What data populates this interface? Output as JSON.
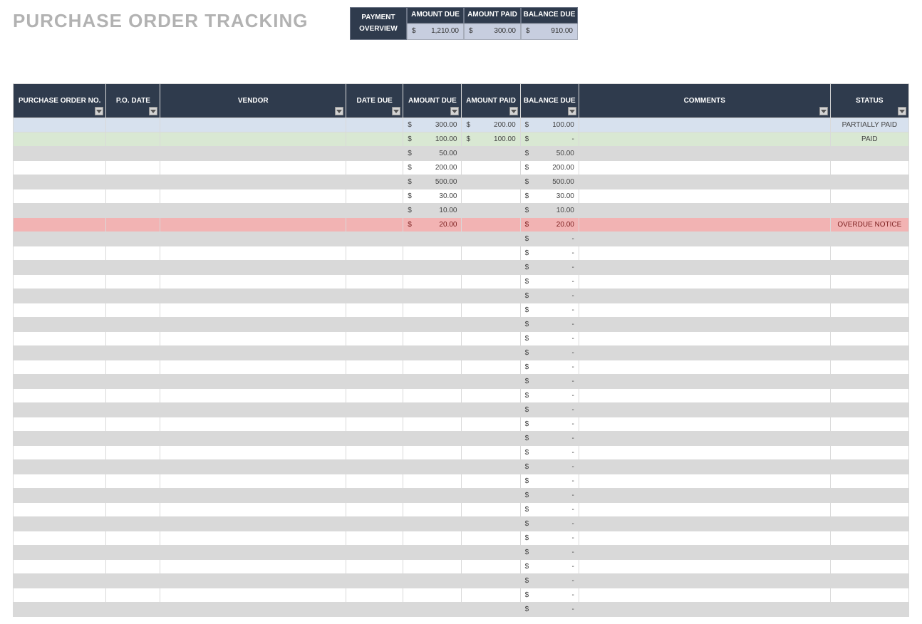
{
  "title": "PURCHASE ORDER TRACKING",
  "overview": {
    "label_line1": "PAYMENT",
    "label_line2": "OVERVIEW",
    "amount_due_label": "AMOUNT DUE",
    "amount_paid_label": "AMOUNT PAID",
    "balance_due_label": "BALANCE DUE",
    "amount_due": "1,210.00",
    "amount_paid": "300.00",
    "balance_due": "910.00",
    "currency": "$"
  },
  "columns": {
    "po_no": "PURCHASE ORDER NO.",
    "po_date": "P.O. DATE",
    "vendor": "VENDOR",
    "date_due": "DATE DUE",
    "amount_due": "AMOUNT DUE",
    "amount_paid": "AMOUNT PAID",
    "balance_due": "BALANCE DUE",
    "comments": "COMMENTS",
    "status": "STATUS"
  },
  "currency": "$",
  "dash": "-",
  "rows": [
    {
      "row_class": "blue",
      "amount_due": "300.00",
      "amount_paid": "200.00",
      "balance_due": "100.00",
      "status": "PARTIALLY PAID"
    },
    {
      "row_class": "green",
      "amount_due": "100.00",
      "amount_paid": "100.00",
      "balance_due": "-",
      "status": "PAID"
    },
    {
      "row_class": "alt",
      "amount_due": "50.00",
      "amount_paid": "",
      "balance_due": "50.00",
      "status": ""
    },
    {
      "row_class": "",
      "amount_due": "200.00",
      "amount_paid": "",
      "balance_due": "200.00",
      "status": ""
    },
    {
      "row_class": "alt",
      "amount_due": "500.00",
      "amount_paid": "",
      "balance_due": "500.00",
      "status": ""
    },
    {
      "row_class": "",
      "amount_due": "30.00",
      "amount_paid": "",
      "balance_due": "30.00",
      "status": ""
    },
    {
      "row_class": "alt",
      "amount_due": "10.00",
      "amount_paid": "",
      "balance_due": "10.00",
      "status": ""
    },
    {
      "row_class": "red",
      "amount_due": "20.00",
      "amount_paid": "",
      "balance_due": "20.00",
      "status": "OVERDUE NOTICE"
    },
    {
      "row_class": "alt",
      "amount_due": "",
      "amount_paid": "",
      "balance_due": "-",
      "status": ""
    },
    {
      "row_class": "",
      "amount_due": "",
      "amount_paid": "",
      "balance_due": "-",
      "status": ""
    },
    {
      "row_class": "alt",
      "amount_due": "",
      "amount_paid": "",
      "balance_due": "-",
      "status": ""
    },
    {
      "row_class": "",
      "amount_due": "",
      "amount_paid": "",
      "balance_due": "-",
      "status": ""
    },
    {
      "row_class": "alt",
      "amount_due": "",
      "amount_paid": "",
      "balance_due": "-",
      "status": ""
    },
    {
      "row_class": "",
      "amount_due": "",
      "amount_paid": "",
      "balance_due": "-",
      "status": ""
    },
    {
      "row_class": "alt",
      "amount_due": "",
      "amount_paid": "",
      "balance_due": "-",
      "status": ""
    },
    {
      "row_class": "",
      "amount_due": "",
      "amount_paid": "",
      "balance_due": "-",
      "status": ""
    },
    {
      "row_class": "alt",
      "amount_due": "",
      "amount_paid": "",
      "balance_due": "-",
      "status": ""
    },
    {
      "row_class": "",
      "amount_due": "",
      "amount_paid": "",
      "balance_due": "-",
      "status": ""
    },
    {
      "row_class": "alt",
      "amount_due": "",
      "amount_paid": "",
      "balance_due": "-",
      "status": ""
    },
    {
      "row_class": "",
      "amount_due": "",
      "amount_paid": "",
      "balance_due": "-",
      "status": ""
    },
    {
      "row_class": "alt",
      "amount_due": "",
      "amount_paid": "",
      "balance_due": "-",
      "status": ""
    },
    {
      "row_class": "",
      "amount_due": "",
      "amount_paid": "",
      "balance_due": "-",
      "status": ""
    },
    {
      "row_class": "alt",
      "amount_due": "",
      "amount_paid": "",
      "balance_due": "-",
      "status": ""
    },
    {
      "row_class": "",
      "amount_due": "",
      "amount_paid": "",
      "balance_due": "-",
      "status": ""
    },
    {
      "row_class": "alt",
      "amount_due": "",
      "amount_paid": "",
      "balance_due": "-",
      "status": ""
    },
    {
      "row_class": "",
      "amount_due": "",
      "amount_paid": "",
      "balance_due": "-",
      "status": ""
    },
    {
      "row_class": "alt",
      "amount_due": "",
      "amount_paid": "",
      "balance_due": "-",
      "status": ""
    },
    {
      "row_class": "",
      "amount_due": "",
      "amount_paid": "",
      "balance_due": "-",
      "status": ""
    },
    {
      "row_class": "alt",
      "amount_due": "",
      "amount_paid": "",
      "balance_due": "-",
      "status": ""
    },
    {
      "row_class": "",
      "amount_due": "",
      "amount_paid": "",
      "balance_due": "-",
      "status": ""
    },
    {
      "row_class": "alt",
      "amount_due": "",
      "amount_paid": "",
      "balance_due": "-",
      "status": ""
    },
    {
      "row_class": "",
      "amount_due": "",
      "amount_paid": "",
      "balance_due": "-",
      "status": ""
    },
    {
      "row_class": "alt",
      "amount_due": "",
      "amount_paid": "",
      "balance_due": "-",
      "status": ""
    },
    {
      "row_class": "",
      "amount_due": "",
      "amount_paid": "",
      "balance_due": "-",
      "status": ""
    },
    {
      "row_class": "alt",
      "amount_due": "",
      "amount_paid": "",
      "balance_due": "-",
      "status": ""
    }
  ]
}
